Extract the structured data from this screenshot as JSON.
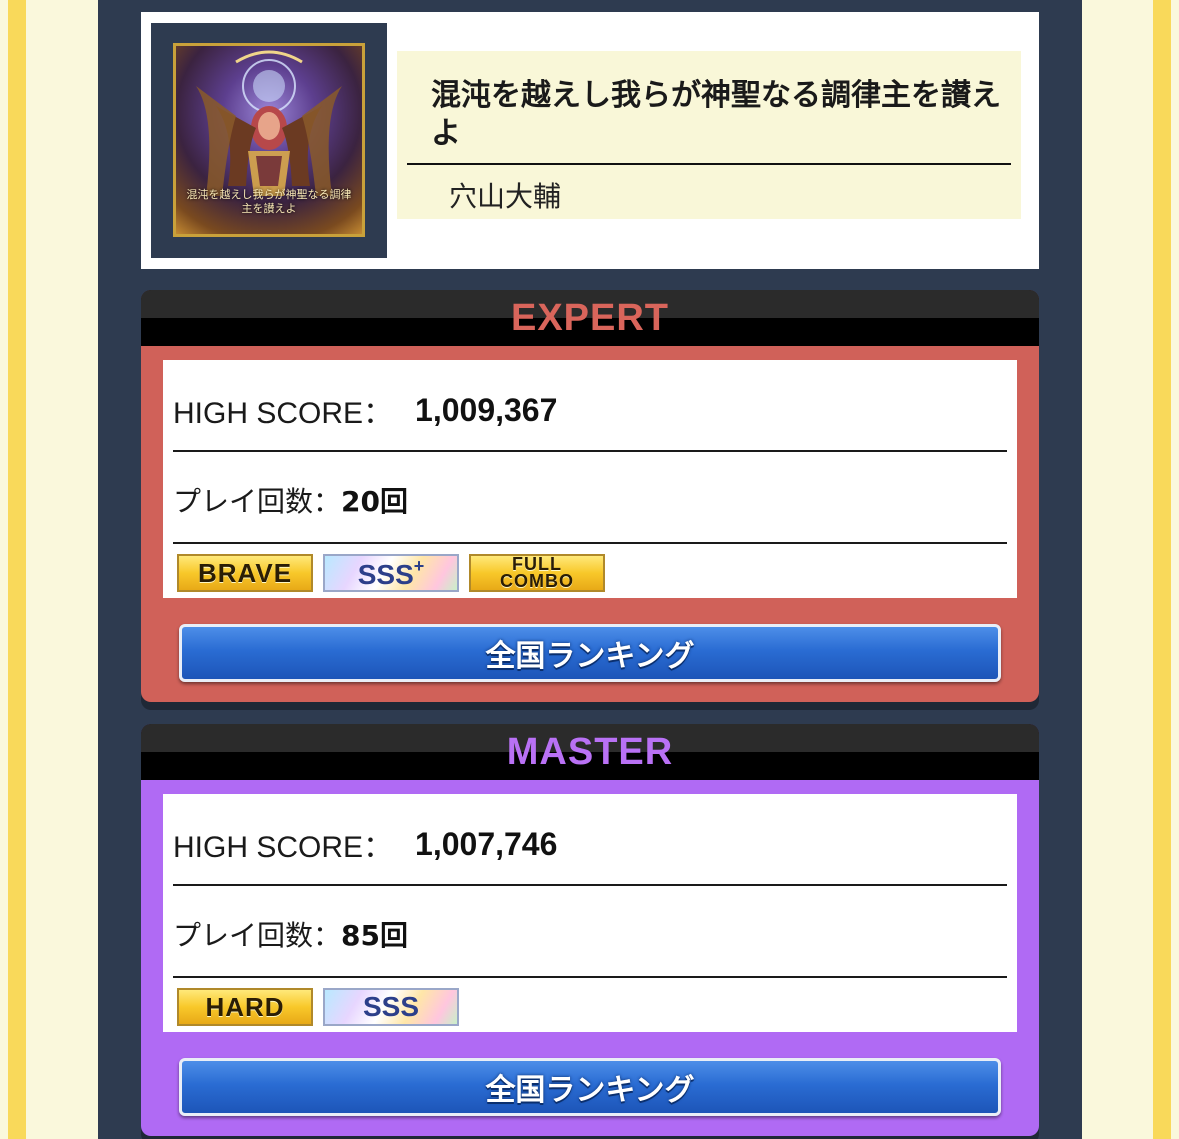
{
  "song": {
    "title": "混沌を越えし我らが神聖なる調律主を讃えよ",
    "artist": "穴山大輔",
    "jacket_caption": "混沌を越えし我らが神聖なる調律主を讃えよ"
  },
  "difficulties": {
    "expert": {
      "name": "EXPERT",
      "color": "#d06159",
      "high_score_label": "HIGH SCORE：",
      "high_score": "1,009,367",
      "plays_label": "プレイ回数：",
      "plays": "20回",
      "badges": [
        "BRAVE",
        "SSS+",
        "FULL COMBO"
      ],
      "ranking_button": "全国ランキング"
    },
    "master": {
      "name": "MASTER",
      "color": "#b06af4",
      "high_score_label": "HIGH SCORE：",
      "high_score": "1,007,746",
      "plays_label": "プレイ回数：",
      "plays": "85回",
      "badges": [
        "HARD",
        "SSS"
      ],
      "ranking_button": "全国ランキング"
    }
  },
  "colors": {
    "page_background": "#faf8dc",
    "side_rail": "#f9d95a",
    "panel": "#2e3b50",
    "button_blue": "#2a6cd3"
  }
}
